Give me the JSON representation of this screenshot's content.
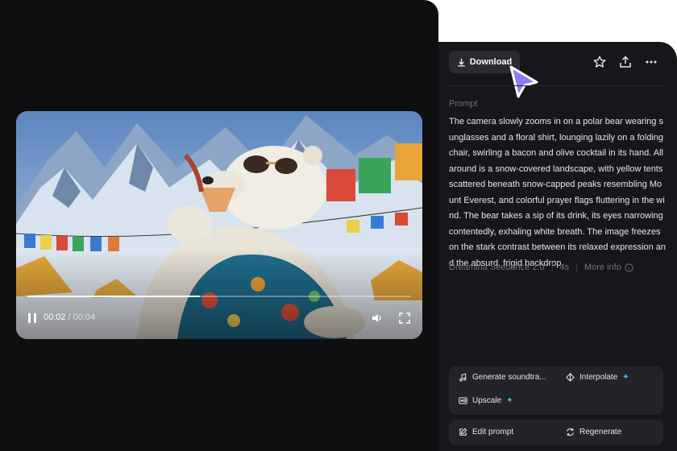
{
  "player": {
    "current_time": "00:02",
    "total_time": "/ 00:04",
    "progress": 0.45
  },
  "header": {
    "download_label": "Download"
  },
  "prompt": {
    "label": "Prompt",
    "text": "The camera slowly zooms in on a polar bear wearing sunglasses and a floral shirt, lounging lazily on a folding chair, swirling a bacon and olive cocktail in its hand. All around is a snow-covered landscape, with yellow tents scattered beneath snow-capped peaks resembling Mount Everest, and colorful prayer flags fluttering in the wind. The bear takes a sip of its drink, its eyes narrowing contentedly, exhaling white breath. The image freezes on the stark contrast between its relaxed expression and the absurd, frigid backdrop."
  },
  "meta": {
    "model": "Dreamina Seedance 2.0",
    "duration": "4s",
    "more_info": "More info"
  },
  "actions": {
    "generate_soundtrack": "Generate soundtra...",
    "interpolate": "Interpolate",
    "upscale": "Upscale",
    "edit_prompt": "Edit prompt",
    "regenerate": "Regenerate",
    "sparkle": "✦"
  },
  "colors": {
    "accent_cursor": "#8b7cf6",
    "sparkle": "#3ac3f0"
  }
}
